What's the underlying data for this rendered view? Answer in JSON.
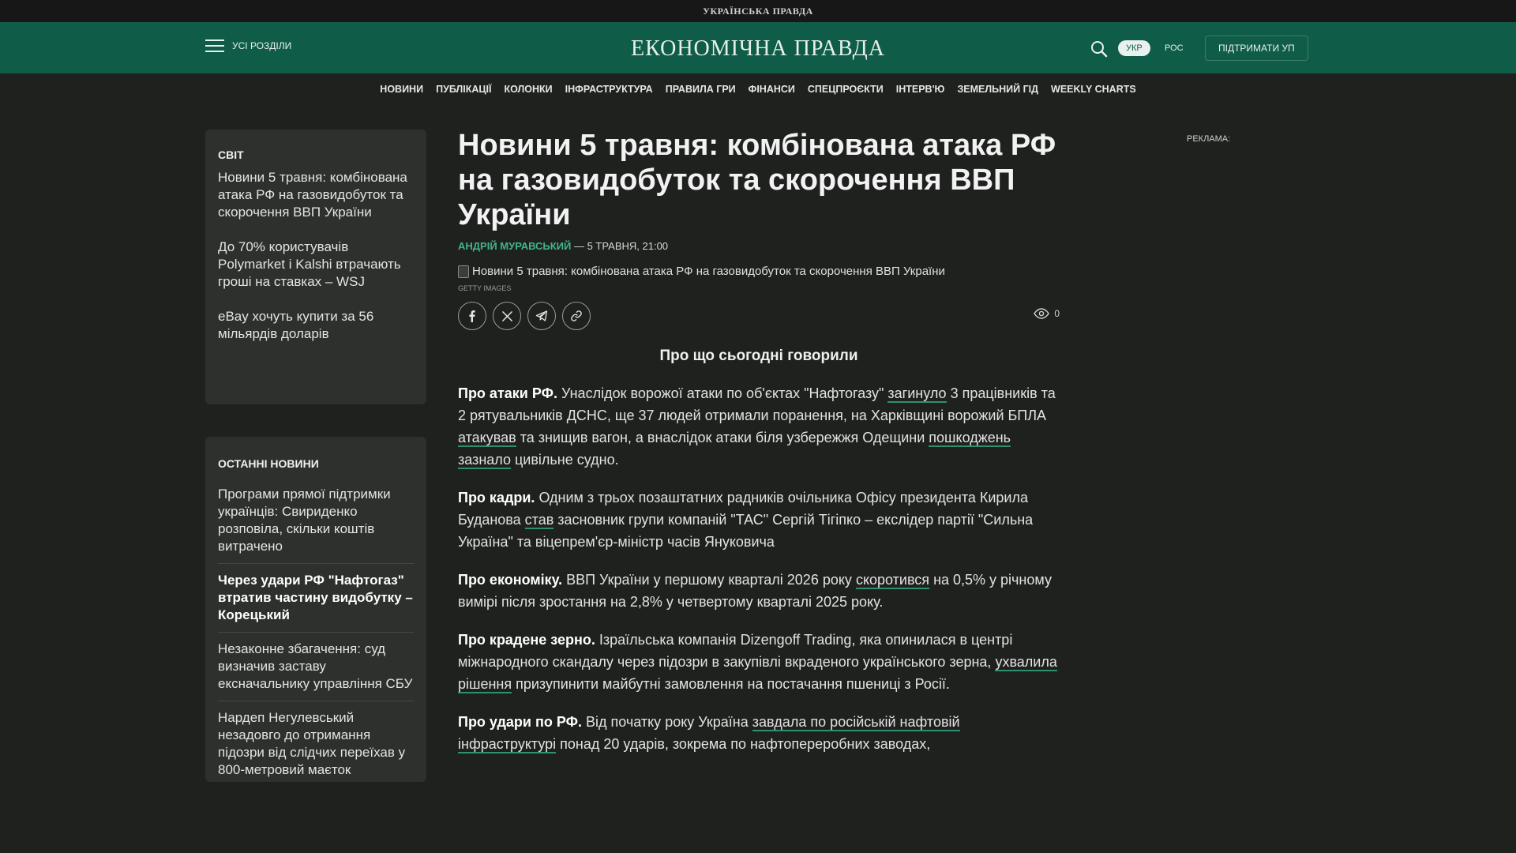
{
  "topbar": {
    "logo": "УКРАЇНСЬКА ПРАВДА"
  },
  "header": {
    "menu_label": "Усі розділи",
    "site_logo": "ЕКОНОМІЧНА ПРАВДА",
    "lang_active": "УКР",
    "lang_other": "РОС",
    "support_label": "ПІДТРИМАТИ УП"
  },
  "nav": [
    "Новини",
    "Публікації",
    "Колонки",
    "Інфраструктура",
    "Правила гри",
    "Фінанси",
    "Спецпроєкти",
    "Інтерв'ю",
    "Земельний гід",
    "Weekly charts"
  ],
  "world": {
    "title": "СВІТ",
    "items": [
      "Новини 5 травня: комбінована атака РФ на газовидобуток та скорочення ВВП України",
      "До 70% користувачів Polymarket і Kalshi втрачають гроші на ставках – WSJ",
      "eBay хочуть купити за 56 мільярдів доларів"
    ]
  },
  "latest": {
    "title": "ОСТАННІ НОВИНИ",
    "items": [
      "Програми прямої підтримки українців: Свириденко розповіла, скільки коштів витрачено",
      "Через удари РФ \"Нафтогаз\" втратив частину видобутку – Корецький",
      "Незаконне збагачення: суд визначив заставу ексначальнику управління СБУ",
      "Нардеп Негулевський незадовго до отримання підозри від слідчих переїхав у 800-метровий маєток"
    ]
  },
  "article": {
    "title": "Новини 5 травня: комбінована атака РФ на газовидобуток та скорочення ВВП України",
    "author": "АНДРІЙ МУРАВСЬКИЙ",
    "date": " — 5 ТРАВНЯ, 21:00",
    "image_alt": "Новини 5 травня: комбінована атака РФ на газовидобуток та скорочення ВВП України",
    "image_credit": "GETTY IMAGES",
    "views": "0",
    "subhead": "Про що сьогодні говорили",
    "p1": {
      "lead": "Про атаки РФ.",
      "t1": " Унаслідок ворожої атаки по об'єктах \"Нафтогазу\" ",
      "l1": "загинуло",
      "t2": " 3 працівників та 2 рятувальників ДСНС, ще 37 людей отримали поранення, на Харківщині ворожий БПЛА ",
      "l2": "атакував",
      "t3": " та знищив вагон, а внаслідок атаки біля узбережжя Одещини ",
      "l3": "пошкоджень зазнало",
      "t4": " цивільне судно."
    },
    "p2": {
      "lead": "Про кадри.",
      "t1": " Одним з трьох позаштатних радників очільника Офісу президента Кирила Буданова ",
      "l1": "став",
      "t2": " засновник групи компаній \"ТАС\" Сергій Тігіпко – екслідер партії \"Сильна Україна\" та віцепрем'єр-міністр часів Януковича"
    },
    "p3": {
      "lead": "Про економіку.",
      "t1": " ВВП України у першому кварталі 2026 року ",
      "l1": "скоротився",
      "t2": " на 0,5% у річному вимірі після зростання на 2,8% у четвертому кварталі 2025 року."
    },
    "p4": {
      "lead": "Про крадене зерно.",
      "t1": " Ізраїльська компанія Dizengoff Trading, яка опинилася в центрі міжнародного скандалу через підозри в закупівлі вкраденого українського зерна, ",
      "l1": "ухвалила рішення",
      "t2": " призупинити майбутні замовлення на постачання пшениці з Росії."
    },
    "p5": {
      "lead": "Про удари по РФ.",
      "t1": " Від початку року Україна ",
      "l1": "завдала по російській нафтовій інфраструктурі",
      "t2": " понад 20 ударів, зокрема по нафтопереробних заводах,"
    }
  },
  "ad_label": "РЕКЛАМА:",
  "colors": {
    "header": "#0f5c48",
    "accent": "#3fb58c",
    "background": "#1f211f",
    "card": "#2d302d"
  },
  "icons": [
    "menu-icon",
    "search-icon",
    "facebook-icon",
    "x-icon",
    "telegram-icon",
    "link-icon",
    "eye-icon"
  ]
}
